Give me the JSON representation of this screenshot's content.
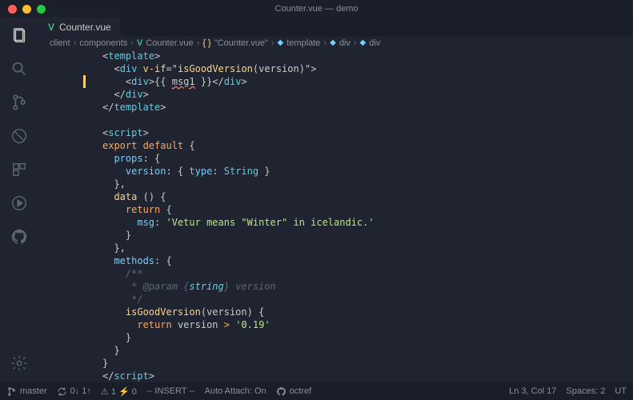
{
  "window": {
    "title": "Counter.vue — demo"
  },
  "tab": {
    "filename": "Counter.vue"
  },
  "breadcrumb": {
    "parts": [
      "client",
      "components",
      "Counter.vue",
      "\"Counter.vue\"",
      "template",
      "div",
      "div"
    ]
  },
  "code": {
    "l1_tag": "template",
    "l2_tag": "div",
    "l2_attr": "v-if",
    "l2_func": "isGoodVersion",
    "l2_arg": "version",
    "l3_tag": "div",
    "l3_expr": "msg1",
    "l6_tag": "script",
    "l7_kw": "export default",
    "l8_prop": "props",
    "l9_prop": "version",
    "l9_type_key": "type",
    "l9_type_val": "String",
    "l11_prop": "data",
    "l12_kw": "return",
    "l13_prop": "msg",
    "l13_str": "'Vetur means \"Winter\" in icelandic.'",
    "l16_prop": "methods",
    "l17_c1": "/**",
    "l18_c2": " * @param {",
    "l18_ctype": "string",
    "l18_c2b": "} version",
    "l19_c3": " */",
    "l20_func": "isGoodVersion",
    "l20_param": "version",
    "l21_kw": "return",
    "l21_var": "version",
    "l21_op": ">",
    "l21_str": "'0.19'"
  },
  "status": {
    "branch": "master",
    "sync": "0↓ 1↑",
    "problems": "⚠ 1 ⚡ 0",
    "mode": "-- INSERT --",
    "attach": "Auto Attach: On",
    "gh": "octref",
    "pos": "Ln 3, Col 17",
    "spaces": "Spaces: 2",
    "enc": "UT"
  }
}
